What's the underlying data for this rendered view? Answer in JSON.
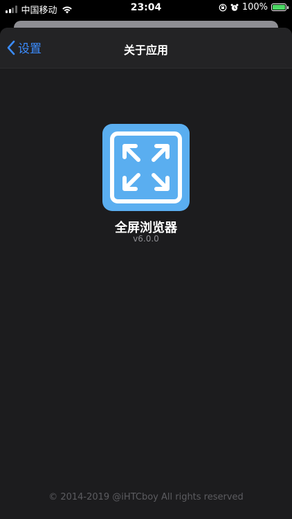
{
  "status_bar": {
    "carrier": "中国移动",
    "time": "23:04",
    "battery": "100%"
  },
  "nav": {
    "back_label": "设置",
    "title": "关于应用"
  },
  "app": {
    "name": "全屏浏览器",
    "version": "v6.0.0",
    "icon": "expand-arrows-icon"
  },
  "footer": {
    "copyright": "© 2014-2019 @iHTCboy All rights reserved"
  },
  "colors": {
    "accent": "#3b8cff",
    "icon_bg": "#5aaef0",
    "background": "#1c1c1e"
  }
}
